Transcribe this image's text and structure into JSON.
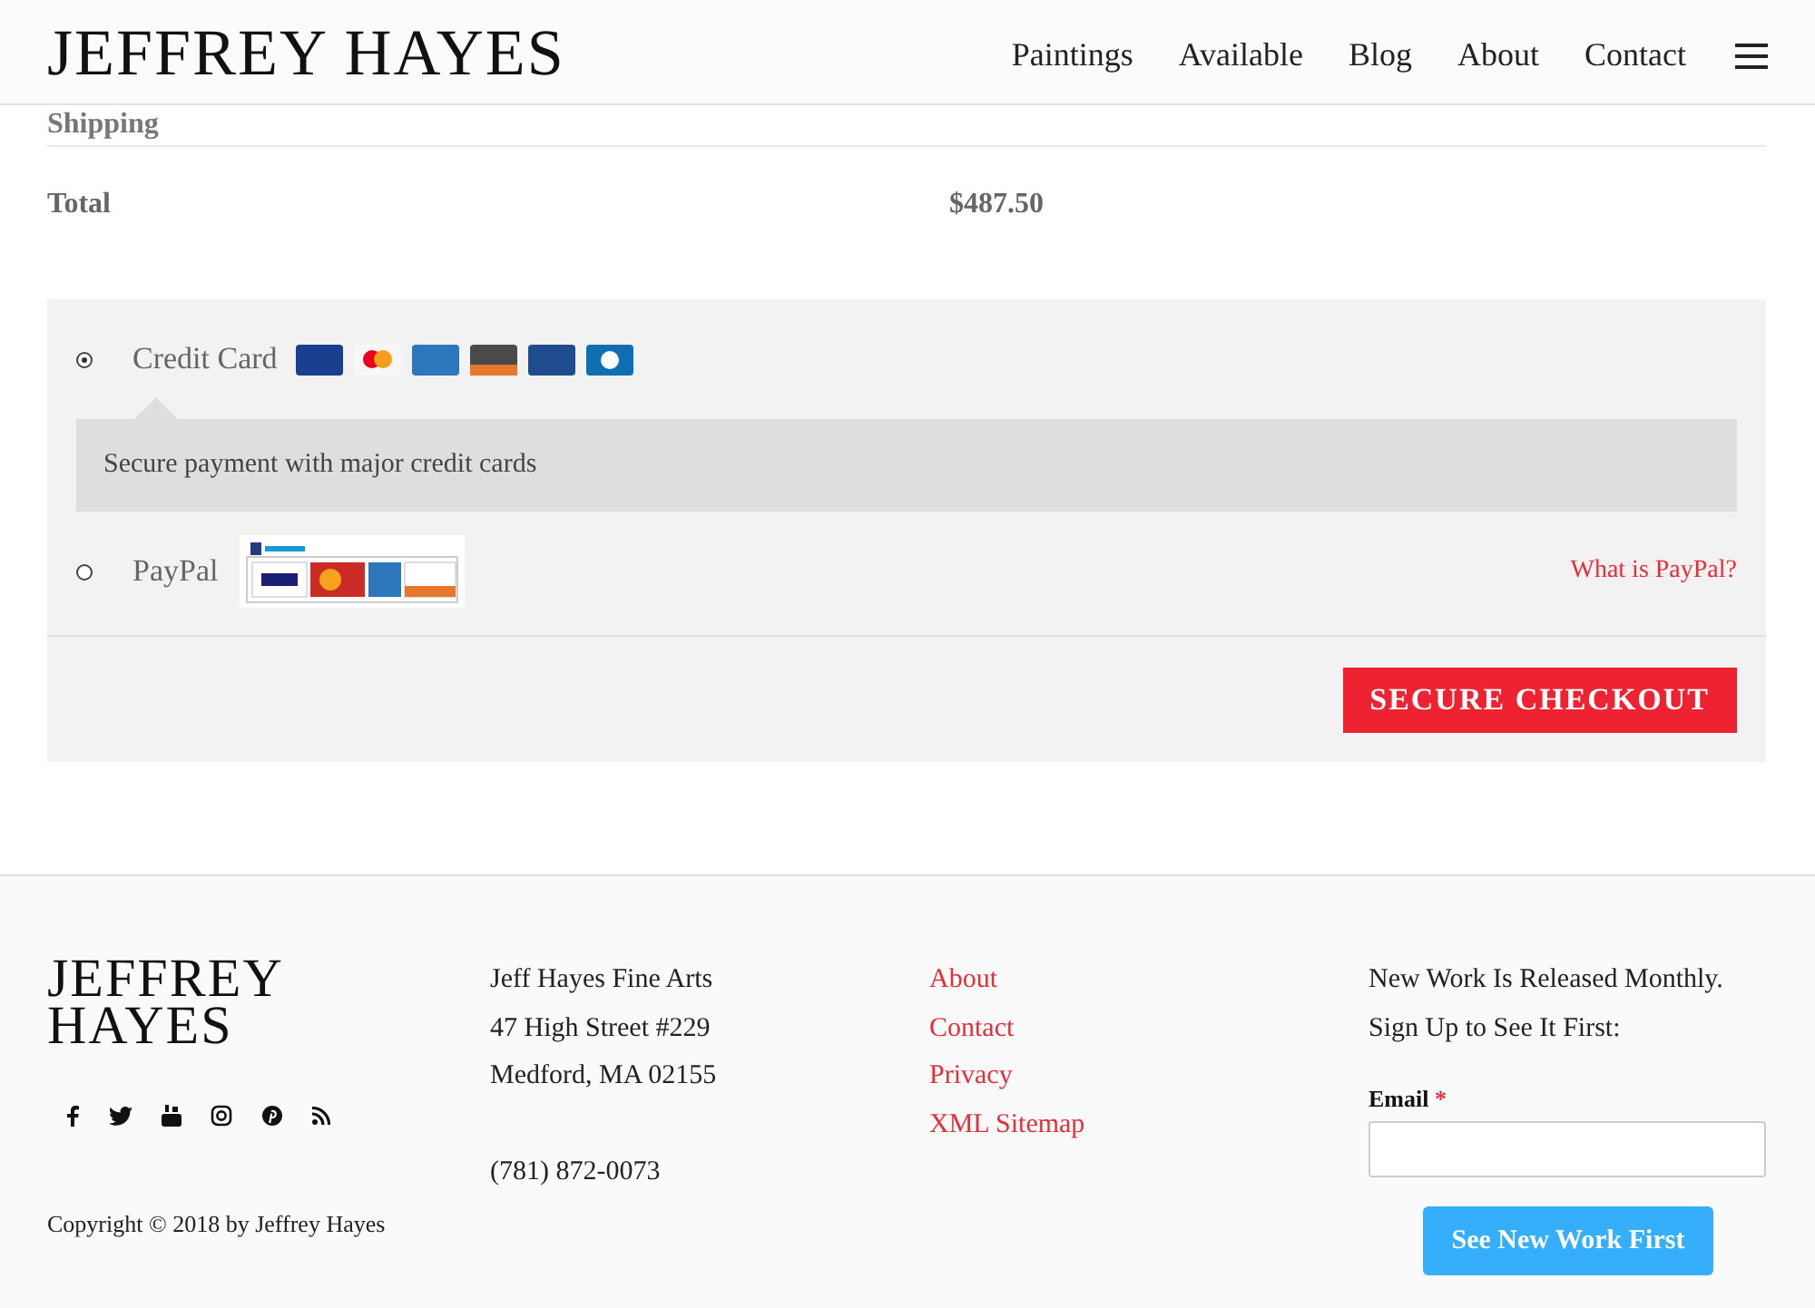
{
  "header": {
    "logo": "JEFFREY HAYES",
    "nav": [
      "Paintings",
      "Available",
      "Blog",
      "About",
      "Contact"
    ]
  },
  "totals": [
    {
      "label": "Shipping"
    },
    {
      "label": "Total",
      "value": "$487.50"
    }
  ],
  "payment_methods": [
    {
      "kind": "card",
      "label": "Credit Card",
      "selected": true,
      "description": "Secure payment with major credit cards"
    },
    {
      "kind": "paypal",
      "label": "PayPal",
      "selected": false,
      "link": "What is PayPal?"
    }
  ],
  "checkout_button": "SECURE CHECKOUT",
  "footer": {
    "logo": "JEFFREY HAYES",
    "copyright": "Copyright © 2018 by Jeffrey Hayes",
    "address": [
      "Jeff Hayes Fine Arts",
      "47 High Street #229",
      "Medford, MA 02155"
    ],
    "phone": "(781) 872-0073",
    "links": [
      "About",
      "Contact",
      "Privacy",
      "XML Sitemap"
    ],
    "signup_text": [
      "New Work Is Released Monthly.",
      "Sign Up to See It First:"
    ],
    "email_label": "Email",
    "required_mark": "*",
    "signup_button": "See New Work First"
  }
}
